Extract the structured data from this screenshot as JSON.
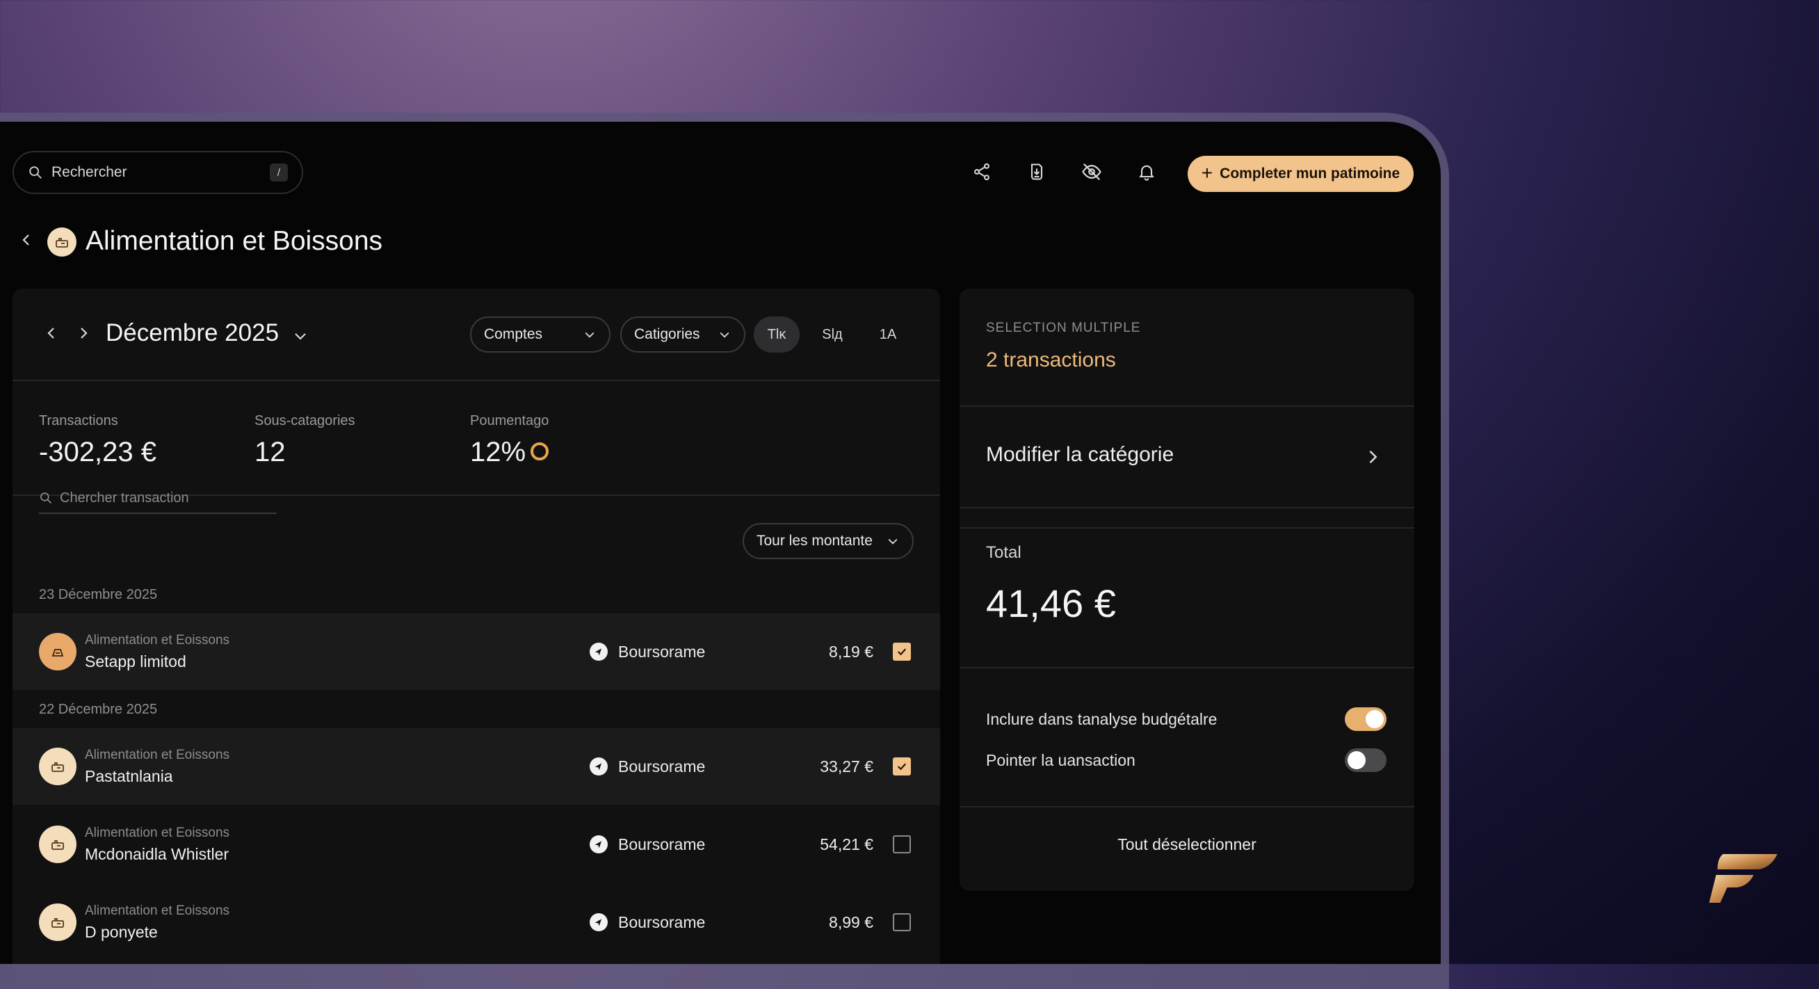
{
  "topbar": {
    "search_placeholder": "Rechercher",
    "search_shortcut": "/",
    "icons": [
      "share-icon",
      "download-icon",
      "eye-off-icon",
      "bell-icon"
    ],
    "cta_label": "Completer mun patimoine"
  },
  "page": {
    "title": "Alimentation et Boissons",
    "category_icon": "category-icon"
  },
  "period": {
    "month": "Décembre 2025",
    "filters": {
      "accounts": "Comptes",
      "categories": "Catigories"
    },
    "ranges": [
      "Tlĸ",
      "Slд",
      "1A"
    ],
    "active_range": 0
  },
  "stats": [
    {
      "label": "Transactions",
      "value": "-302,23 €"
    },
    {
      "label": "Sous-catagories",
      "value": "12"
    },
    {
      "label": "Poumentago",
      "value": "12%"
    }
  ],
  "transactions": {
    "search_placeholder": "Chercher transaction",
    "amount_filter": "Tour les montante",
    "groups": [
      {
        "date": "23 Décembre 2025"
      },
      {
        "date": "22 Décembre 2025"
      }
    ],
    "rows": [
      {
        "category": "Alimentation et Eoissons",
        "name": "Setapp limitod",
        "bank": "Boursorame",
        "amount": "8,19 €",
        "checked": true
      },
      {
        "category": "Alimentation et Eoissons",
        "name": "Pastatnlania",
        "bank": "Boursorame",
        "amount": "33,27 €",
        "checked": true
      },
      {
        "category": "Alimentation et Eoissons",
        "name": "Mcdonaidla Whistler",
        "bank": "Boursorame",
        "amount": "54,21 €",
        "checked": false
      },
      {
        "category": "Alimentation et Eoissons",
        "name": "D ponyete",
        "bank": "Boursorame",
        "amount": "8,99 €",
        "checked": false
      }
    ]
  },
  "selection": {
    "kicker": "SELECTION MULTIPLE",
    "count": "2 transactions",
    "modify_label": "Modifier la catégorie",
    "total_label": "Total",
    "total_value": "41,46 €",
    "toggles": [
      {
        "label": "Inclure dans tanalyse budgétalre",
        "on": true
      },
      {
        "label": "Pointer la uansaction",
        "on": false
      }
    ],
    "deselect_label": "Tout déselectionner"
  },
  "colors": {
    "accent": "#f2c38a",
    "accent_text": "#f0b97a",
    "panel": "#111112",
    "background": "#050505"
  }
}
